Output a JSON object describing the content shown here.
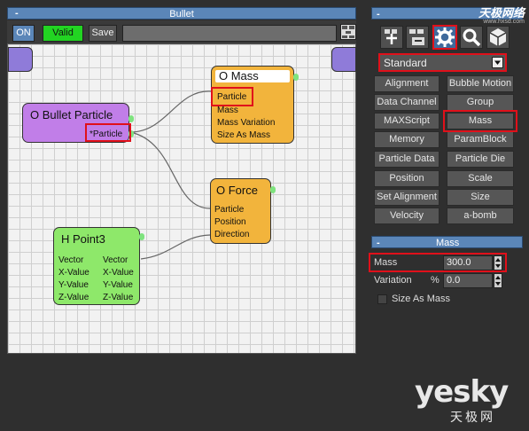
{
  "graph_window": {
    "title": "Bullet",
    "on_label": "ON",
    "valid_label": "Valid",
    "save_label": "Save"
  },
  "nodes": {
    "bullet_particle": {
      "title": "O Bullet Particle",
      "output": "*Particle"
    },
    "mass": {
      "title": "O Mass",
      "inputs": [
        "Particle",
        "Mass",
        "Mass Variation",
        "Size As Mass"
      ]
    },
    "force": {
      "title": "O Force",
      "inputs": [
        "Particle",
        "Position",
        "Direction"
      ]
    },
    "point3": {
      "title": "H Point3",
      "left": [
        "Vector",
        "X-Value",
        "Y-Value",
        "Z-Value"
      ],
      "right": [
        "Vector",
        "X-Value",
        "Y-Value",
        "Z-Value"
      ]
    }
  },
  "right_panel": {
    "top_bar_label": "-",
    "icons": [
      "add-node-icon",
      "expand-icon",
      "gear-icon",
      "search-icon",
      "cube-icon"
    ],
    "dropdown_value": "Standard",
    "operators": [
      [
        "Alignment",
        "Bubble Motion"
      ],
      [
        "Data Channel",
        "Group"
      ],
      [
        "MAXScript",
        "Mass"
      ],
      [
        "Memory",
        "ParamBlock"
      ],
      [
        "Particle Data",
        "Particle Die"
      ],
      [
        "Position",
        "Scale"
      ],
      [
        "Set Alignment",
        "Size"
      ],
      [
        "Velocity",
        "a-bomb"
      ]
    ],
    "mass_rollout": {
      "title": "Mass",
      "mass_label": "Mass",
      "mass_value": "300.0",
      "variation_label": "Variation",
      "variation_unit": "%",
      "variation_value": "0.0",
      "size_as_mass_label": "Size As Mass"
    }
  },
  "watermark": {
    "top_right": "天极网络",
    "top_right_url": "www.hxsd.com",
    "brand": "yesky",
    "brand_cn": "天极网"
  },
  "colors": {
    "title_bar": "#5b86b8",
    "node_orange": "#f2b43c",
    "node_purple": "#c17ee8",
    "node_green": "#8ee86a",
    "highlight_red": "#e0101a"
  }
}
